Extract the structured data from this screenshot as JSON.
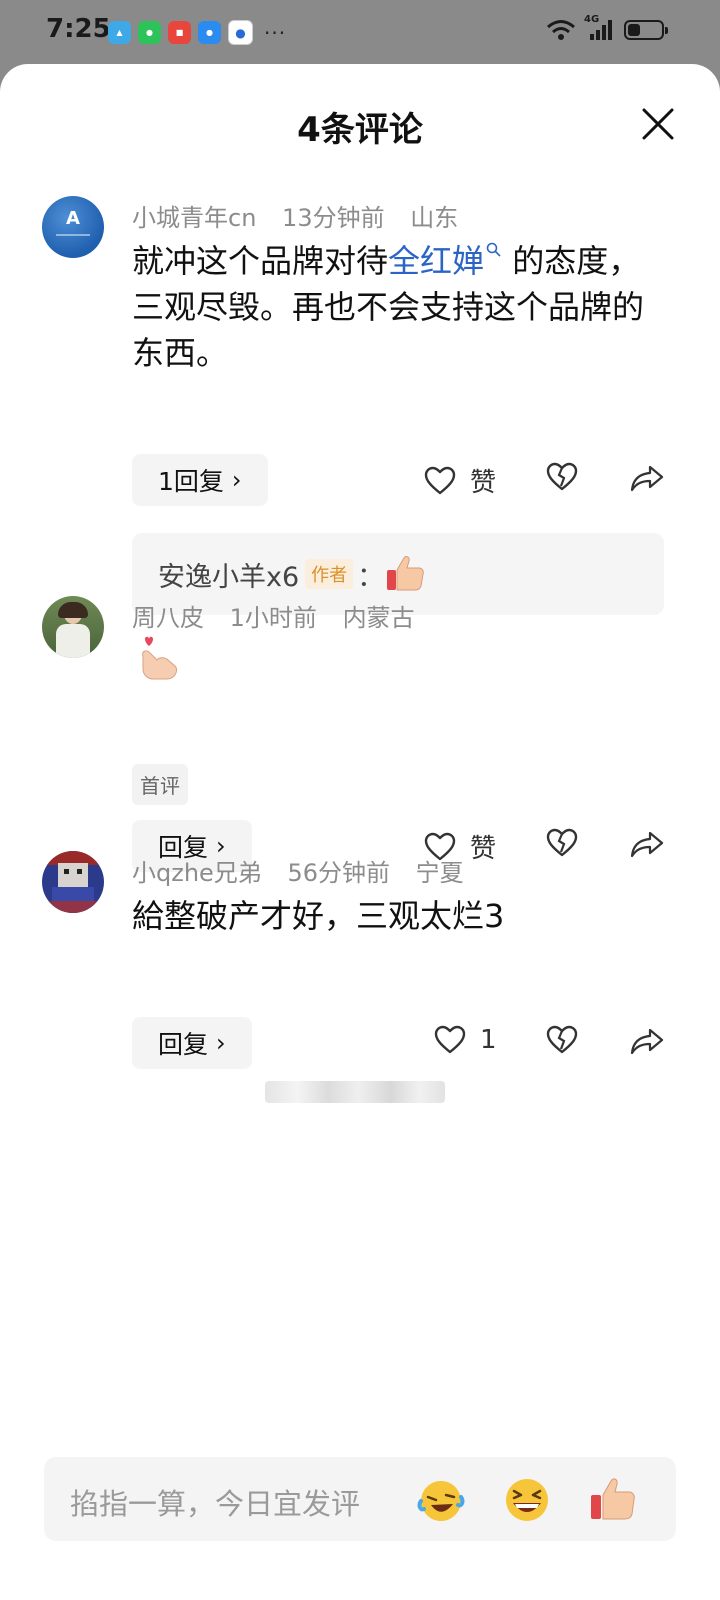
{
  "status_bar": {
    "time": "7:25",
    "network": "4G"
  },
  "sheet": {
    "title": "4条评论"
  },
  "comments": [
    {
      "username": "小城青年cn",
      "time": "13分钟前",
      "location": "山东",
      "text_before": "就冲这个品牌对待",
      "link": "全红婵",
      "text_after": " 的态度，三观尽毁。再也不会支持这个品牌的东西。",
      "reply_count_label": "1回复",
      "like_label": "赞",
      "reply": {
        "user": "安逸小羊x6",
        "tag": "作者",
        "sep": "："
      }
    },
    {
      "username": "周八皮",
      "time": "1小时前",
      "location": "内蒙古",
      "first_tag": "首评",
      "reply_label": "回复",
      "like_label": "赞"
    },
    {
      "username": "小qzhe兄弟",
      "time": "56分钟前",
      "location": "宁夏",
      "text": "給整破产才好，三观太烂3",
      "reply_label": "回复",
      "like_count": "1"
    }
  ],
  "input": {
    "placeholder": "掐指一算，今日宜发评"
  },
  "colors": {
    "link": "#2b64c7",
    "author_tag": "#d9922c",
    "avatar_blue": "#1f5fae"
  }
}
